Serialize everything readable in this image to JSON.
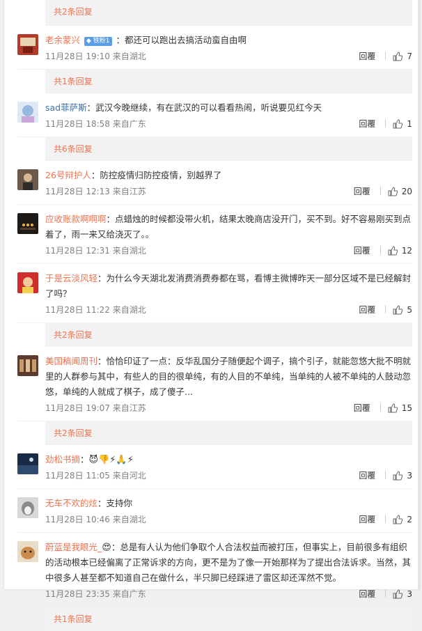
{
  "colors": {
    "name": "#eb7350",
    "more_bar_bg": "#f2f2f2",
    "meta": "#808080"
  },
  "labels": {
    "reply": "回覆",
    "like_icon": "thumbs-up-icon"
  },
  "more_bars": [
    "共2条回复",
    "共1条回复",
    "共6条回复",
    "共2条回复",
    "共2条回复",
    "共2条回复",
    "共1条回复"
  ],
  "comments": [
    {
      "name": "老余蒙兴",
      "badge": "铁粉1",
      "content": "：都还可以跑出去搞活动蛮自由啊",
      "time": "11月28日 19:10 来自湖北",
      "likes": "7"
    },
    {
      "name": "sad菲萨斯",
      "content": "：武汉今晚继续，有在武汉的可以看看热闹，听说要见红今天",
      "time": "11月28日 18:58 来自广东",
      "likes": "1"
    },
    {
      "name": "26号辩护人",
      "content": "：防控疫情归防控疫情，别越界了",
      "time": "11月28日 12:13 来自江苏",
      "likes": "20"
    },
    {
      "name": "应收账款啊啊啊",
      "content": "：点蜡烛的时候都没带火机，结果太晚商店没开门，买不到。好不容易刚买到点着了，雨一来又给浇灭了。。",
      "time": "11月28日 12:31 来自湖北",
      "likes": "12"
    },
    {
      "name": "于是云淡风轻",
      "content": "：为什么今天湖北发消费消费券都在骂，看博主微博昨天一部分区域不是已经解封了吗？",
      "time": "11月28日 11:22 来自湖北",
      "likes": "5"
    },
    {
      "name": "美国稿闻周刊",
      "content": "：恰恰印证了一点：反华乱国分子随便起个调子，搞个引子，就能忽悠大批不明就里的人群参与其中，有些人的目的很单纯，有的人目的不单纯，当单纯的人被不单纯的人鼓动忽悠，单纯的人就成了棋子，成了傻子...",
      "time": "11月28日 19:07 来自江苏",
      "likes": "15"
    },
    {
      "name": "劲松书摘",
      "content": "：",
      "emojis": "😈👎⚡🙏⚡",
      "time": "11月28日 11:05 来自河北",
      "likes": "3"
    },
    {
      "name": "无车不欢的炫",
      "content": "：支持你",
      "time": "11月28日 10:46 来自湖北",
      "likes": "2"
    },
    {
      "name": "蔚蓝是我眼光_",
      "name_emoji": "😍",
      "content": "：总是有人认为他们争取个人合法权益而被打压，但事实上，目前很多有组织的活动根本已经偏离了正常诉求的方向，更不是为了像一开始那样为了提出合法诉求。当然，其中很多人甚至都不知道自己在做什么，半只脚已经踩进了雷区却还浑然不觉。",
      "time": "11月28日 23:35 来自广东",
      "likes": "3"
    }
  ]
}
